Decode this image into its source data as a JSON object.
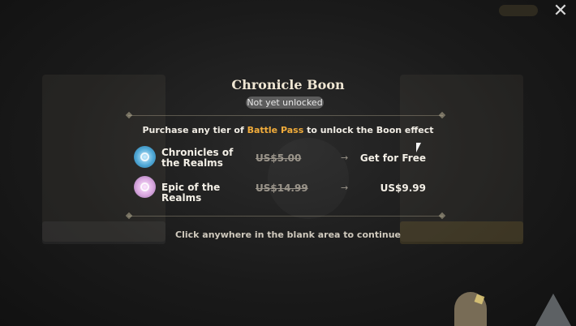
{
  "dialog": {
    "title": "Chronicle Boon",
    "status_badge": "Not yet unlocked",
    "subtitle_prefix": "Purchase any tier of ",
    "subtitle_highlight": "Battle Pass",
    "subtitle_suffix": " to unlock the Boon effect",
    "tiers": [
      {
        "name": "Chronicles of the Realms",
        "old_price": "US$5.00",
        "arrow": "→",
        "new_price": "Get for Free",
        "icon": "blue-star-gem-icon"
      },
      {
        "name": "Epic of the Realms",
        "old_price": "US$14.99",
        "arrow": "→",
        "new_price": "US$9.99",
        "icon": "purple-star-gem-icon"
      }
    ],
    "hint": "Click anywhere in the blank area to continue"
  },
  "window": {
    "close_icon": "close-icon"
  },
  "colors": {
    "highlight": "#f1ac3b",
    "badge_bg": "#5c5c5c"
  }
}
